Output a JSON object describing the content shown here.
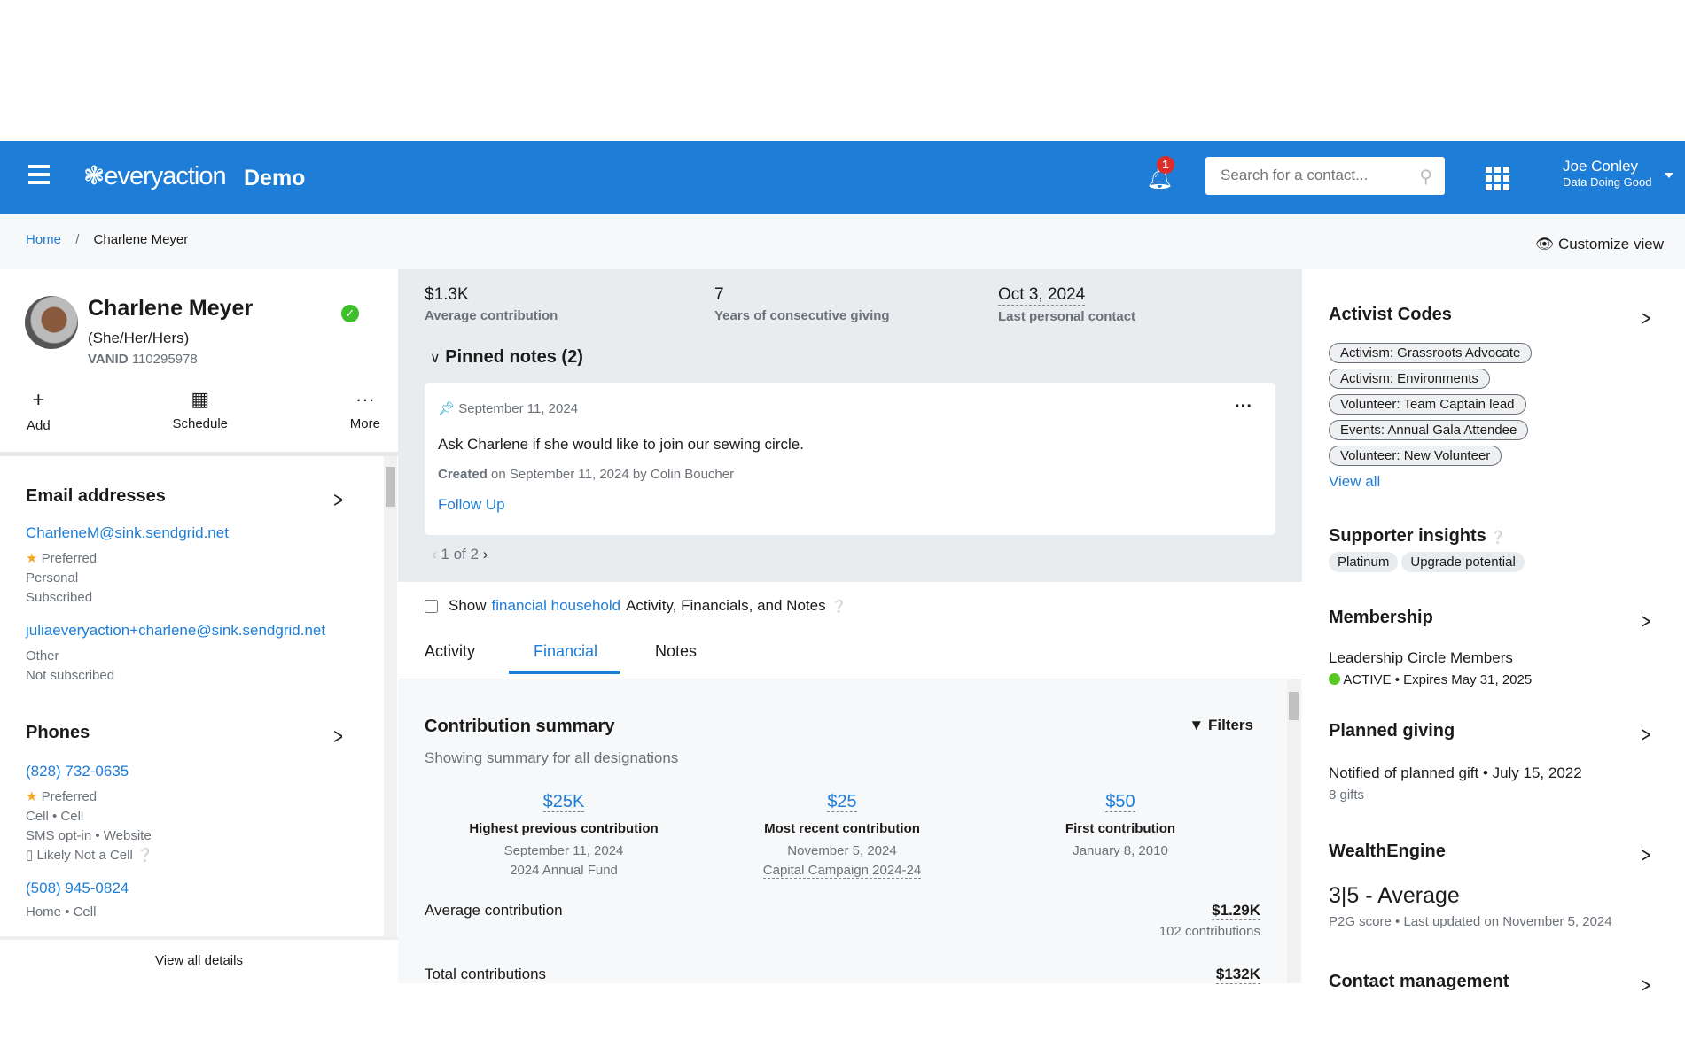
{
  "header": {
    "brand": "everyaction",
    "env": "Demo",
    "notification_count": "1",
    "search_placeholder": "Search for a contact...",
    "user_name": "Joe Conley",
    "user_org": "Data Doing Good",
    "color": "#1e7dd6"
  },
  "breadcrumb": {
    "home": "Home",
    "current": "Charlene Meyer",
    "customize": "Customize view"
  },
  "profile": {
    "name": "Charlene Meyer",
    "pronouns": "(She/Her/Hers)",
    "vanid_label": "VANID",
    "vanid": "110295978",
    "actions": [
      {
        "label": "Add",
        "icon": "plus-icon"
      },
      {
        "label": "Schedule",
        "icon": "calendar-icon"
      },
      {
        "label": "More",
        "icon": "ellipsis-icon"
      }
    ]
  },
  "emails": {
    "title": "Email addresses",
    "items": [
      {
        "address": "CharleneM@sink.sendgrid.net",
        "preferred": "Preferred",
        "type": "Personal",
        "status": "Subscribed"
      },
      {
        "address": "juliaeveryaction+charlene@sink.sendgrid.net",
        "type": "Other",
        "status": "Not subscribed"
      }
    ]
  },
  "phones": {
    "title": "Phones",
    "items": [
      {
        "number": "(828) 732-0635",
        "preferred": "Preferred",
        "line1": "Cell • Cell",
        "line2": "SMS opt-in • Website",
        "line3": "Likely Not a Cell"
      },
      {
        "number": "(508) 945-0824",
        "line1": "Home • Cell"
      }
    ]
  },
  "view_all_details": "View all details",
  "stats": [
    {
      "value": "$1.3K",
      "label": "Average contribution"
    },
    {
      "value": "7",
      "label": "Years of consecutive giving"
    },
    {
      "value": "Oct 3, 2024",
      "label": "Last personal contact"
    }
  ],
  "pinned": {
    "title": "Pinned notes (2)",
    "date": "September 11, 2024",
    "text": "Ask Charlene if she would like to join our sewing circle.",
    "created_prefix": "Created",
    "created_rest": "on September 11, 2024 by Colin Boucher",
    "action": "Follow Up",
    "pager": "1 of 2"
  },
  "household": {
    "prefix": "Show",
    "link": "financial household",
    "suffix": "Activity, Financials, and Notes",
    "checked": false
  },
  "tabs": [
    {
      "label": "Activity",
      "active": false
    },
    {
      "label": "Financial",
      "active": true
    },
    {
      "label": "Notes",
      "active": false
    }
  ],
  "summary": {
    "title": "Contribution summary",
    "subtitle": "Showing summary for all designations",
    "filters": "Filters",
    "cards": [
      {
        "value": "$25K",
        "label": "Highest previous contribution",
        "line1": "September 11, 2024",
        "line2": "2024 Annual Fund"
      },
      {
        "value": "$25",
        "label": "Most recent contribution",
        "line1": "November 5, 2024",
        "line2": "Capital Campaign 2024-24"
      },
      {
        "value": "$50",
        "label": "First contribution",
        "line1": "January 8, 2010"
      }
    ],
    "avg_label": "Average contribution",
    "avg_value": "$1.29K",
    "avg_sub": "102 contributions",
    "total_label": "Total contributions",
    "total_value": "$132K"
  },
  "right": {
    "activist_title": "Activist Codes",
    "codes": [
      "Activism: Grassroots Advocate",
      "Activism: Environments",
      "Volunteer: Team Captain lead",
      "Events: Annual Gala Attendee",
      "Volunteer: New Volunteer"
    ],
    "view_all": "View all",
    "insights_title": "Supporter insights",
    "insights": [
      "Platinum",
      "Upgrade potential"
    ],
    "membership_title": "Membership",
    "membership_name": "Leadership Circle Members",
    "membership_status": "ACTIVE",
    "membership_expires": "• Expires May 31, 2025",
    "planned_title": "Planned giving",
    "planned_text": "Notified of planned gift • July 15, 2022",
    "planned_sub": "8 gifts",
    "wealth_title": "WealthEngine",
    "wealth_score": "3|5 - Average",
    "wealth_sub": "P2G score • Last updated on November 5, 2024",
    "contact_title": "Contact management"
  }
}
